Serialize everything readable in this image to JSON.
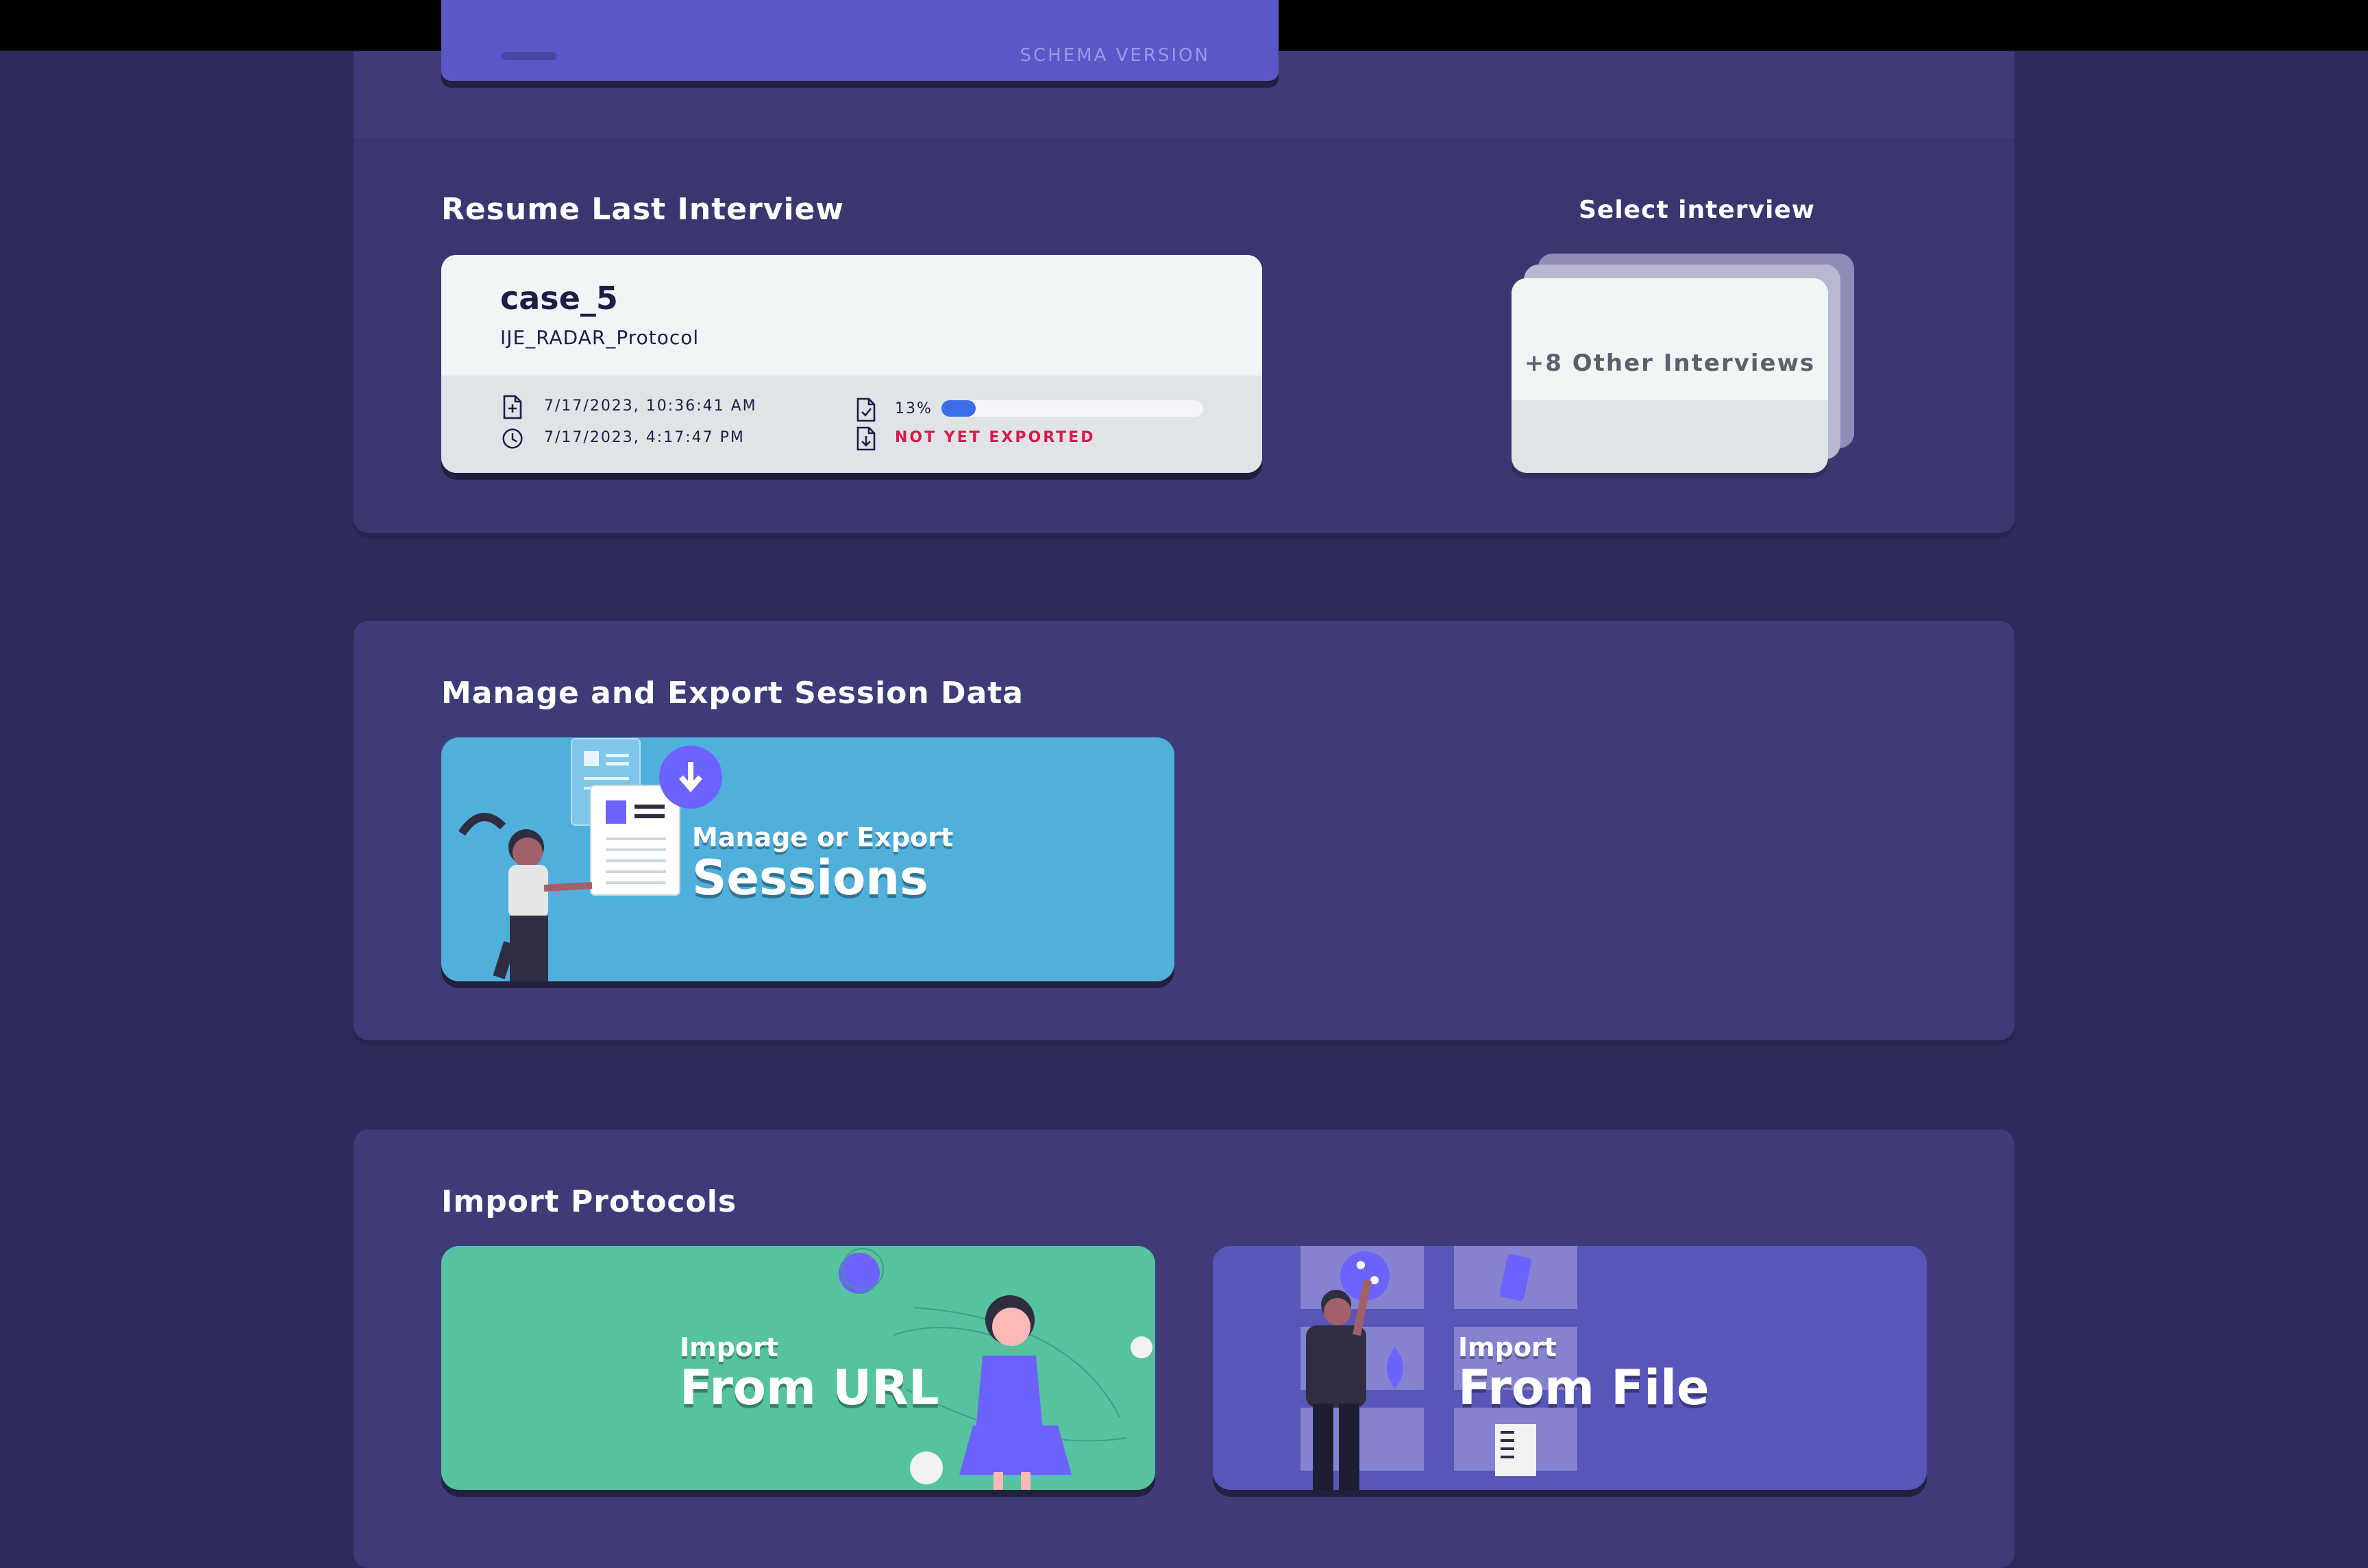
{
  "previous_card": {
    "faint_text": "SCHEMA VERSION"
  },
  "resume": {
    "title": "Resume Last Interview",
    "card": {
      "case_id": "case_5",
      "protocol": "IJE_RADAR_Protocol",
      "created": "7/17/2023, 10:36:41 AM",
      "updated": "7/17/2023, 4:17:47 PM",
      "progress_text": "13%",
      "progress_value": 0.13,
      "export_status": "NOT YET EXPORTED"
    },
    "select_label": "Select interview",
    "others_label": "+8 Other Interviews"
  },
  "manage": {
    "title": "Manage and Export Session Data",
    "tile_small": "Manage or Export",
    "tile_big": "Sessions"
  },
  "import": {
    "title": "Import Protocols",
    "url_small": "Import",
    "url_big": "From URL",
    "file_small": "Import",
    "file_big": "From File"
  },
  "colors": {
    "background": "#2e2b5c",
    "panel": "#3e3b78",
    "sessions_tile": "#4fb0dc",
    "url_tile": "#55c3a0",
    "file_tile": "#5856b8",
    "accent_purple": "#6c63ff",
    "progress_blue": "#3b6ee8",
    "error_red": "#d81b4b"
  }
}
